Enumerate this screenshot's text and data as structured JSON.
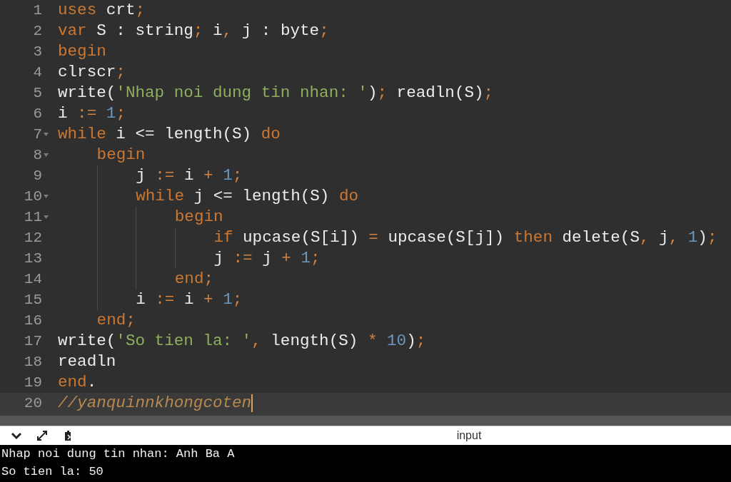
{
  "editor": {
    "lines": [
      {
        "number": "1",
        "foldable": false,
        "active": false,
        "tokens": [
          {
            "kind": "kw",
            "text": "uses"
          },
          {
            "kind": "id",
            "text": " crt"
          },
          {
            "kind": "op",
            "text": ";"
          }
        ]
      },
      {
        "number": "2",
        "foldable": false,
        "active": false,
        "tokens": [
          {
            "kind": "kw",
            "text": "var"
          },
          {
            "kind": "id",
            "text": " S : string"
          },
          {
            "kind": "op",
            "text": ";"
          },
          {
            "kind": "id",
            "text": " i"
          },
          {
            "kind": "op",
            "text": ","
          },
          {
            "kind": "id",
            "text": " j : byte"
          },
          {
            "kind": "op",
            "text": ";"
          }
        ]
      },
      {
        "number": "3",
        "foldable": false,
        "active": false,
        "tokens": [
          {
            "kind": "kw",
            "text": "begin"
          }
        ]
      },
      {
        "number": "4",
        "foldable": false,
        "active": false,
        "tokens": [
          {
            "kind": "id",
            "text": "clrscr"
          },
          {
            "kind": "op",
            "text": ";"
          }
        ]
      },
      {
        "number": "5",
        "foldable": false,
        "active": false,
        "tokens": [
          {
            "kind": "id",
            "text": "write("
          },
          {
            "kind": "str",
            "text": "'Nhap noi dung tin nhan: '"
          },
          {
            "kind": "id",
            "text": ")"
          },
          {
            "kind": "op",
            "text": ";"
          },
          {
            "kind": "id",
            "text": " readln(S)"
          },
          {
            "kind": "op",
            "text": ";"
          }
        ]
      },
      {
        "number": "6",
        "foldable": false,
        "active": false,
        "tokens": [
          {
            "kind": "id",
            "text": "i"
          },
          {
            "kind": "op",
            "text": " :="
          },
          {
            "kind": "num",
            "text": " 1"
          },
          {
            "kind": "op",
            "text": ";"
          }
        ]
      },
      {
        "number": "7",
        "foldable": true,
        "active": false,
        "tokens": [
          {
            "kind": "kw",
            "text": "while"
          },
          {
            "kind": "id",
            "text": " i <= length(S)"
          },
          {
            "kind": "kw",
            "text": " do"
          }
        ],
        "children": [
          {
            "number": "8",
            "foldable": true,
            "active": false,
            "tokens": [
              {
                "kind": "kw",
                "text": "begin"
              }
            ],
            "children": [
              {
                "number": "9",
                "foldable": false,
                "active": false,
                "tokens": [
                  {
                    "kind": "id",
                    "text": "j"
                  },
                  {
                    "kind": "op",
                    "text": " :="
                  },
                  {
                    "kind": "id",
                    "text": " i"
                  },
                  {
                    "kind": "op",
                    "text": " +"
                  },
                  {
                    "kind": "num",
                    "text": " 1"
                  },
                  {
                    "kind": "op",
                    "text": ";"
                  }
                ]
              },
              {
                "number": "10",
                "foldable": true,
                "active": false,
                "tokens": [
                  {
                    "kind": "kw",
                    "text": "while"
                  },
                  {
                    "kind": "id",
                    "text": " j <= length(S)"
                  },
                  {
                    "kind": "kw",
                    "text": " do"
                  }
                ],
                "children": [
                  {
                    "number": "11",
                    "foldable": true,
                    "active": false,
                    "tokens": [
                      {
                        "kind": "kw",
                        "text": "begin"
                      }
                    ],
                    "children": [
                      {
                        "number": "12",
                        "foldable": false,
                        "active": false,
                        "tokens": [
                          {
                            "kind": "kw",
                            "text": "if"
                          },
                          {
                            "kind": "id",
                            "text": " upcase(S[i])"
                          },
                          {
                            "kind": "op",
                            "text": " ="
                          },
                          {
                            "kind": "id",
                            "text": " upcase(S[j])"
                          },
                          {
                            "kind": "kw",
                            "text": " then"
                          },
                          {
                            "kind": "id",
                            "text": " delete(S"
                          },
                          {
                            "kind": "op",
                            "text": ","
                          },
                          {
                            "kind": "id",
                            "text": " j"
                          },
                          {
                            "kind": "op",
                            "text": ","
                          },
                          {
                            "kind": "num",
                            "text": " 1"
                          },
                          {
                            "kind": "id",
                            "text": ")"
                          },
                          {
                            "kind": "op",
                            "text": ";"
                          }
                        ]
                      },
                      {
                        "number": "13",
                        "foldable": false,
                        "active": false,
                        "tokens": [
                          {
                            "kind": "id",
                            "text": "j"
                          },
                          {
                            "kind": "op",
                            "text": " :="
                          },
                          {
                            "kind": "id",
                            "text": " j"
                          },
                          {
                            "kind": "op",
                            "text": " +"
                          },
                          {
                            "kind": "num",
                            "text": " 1"
                          },
                          {
                            "kind": "op",
                            "text": ";"
                          }
                        ]
                      }
                    ]
                  },
                  {
                    "number": "14",
                    "foldable": false,
                    "active": false,
                    "tokens": [
                      {
                        "kind": "kw",
                        "text": "end"
                      },
                      {
                        "kind": "op",
                        "text": ";"
                      }
                    ]
                  }
                ]
              },
              {
                "number": "15",
                "foldable": false,
                "active": false,
                "tokens": [
                  {
                    "kind": "id",
                    "text": "i"
                  },
                  {
                    "kind": "op",
                    "text": " :="
                  },
                  {
                    "kind": "id",
                    "text": " i"
                  },
                  {
                    "kind": "op",
                    "text": " +"
                  },
                  {
                    "kind": "num",
                    "text": " 1"
                  },
                  {
                    "kind": "op",
                    "text": ";"
                  }
                ]
              }
            ]
          },
          {
            "number": "16",
            "foldable": false,
            "active": false,
            "tokens": [
              {
                "kind": "kw",
                "text": "end"
              },
              {
                "kind": "op",
                "text": ";"
              }
            ]
          }
        ]
      },
      {
        "number": "17",
        "foldable": false,
        "active": false,
        "tokens": [
          {
            "kind": "id",
            "text": "write("
          },
          {
            "kind": "str",
            "text": "'So tien la: '"
          },
          {
            "kind": "op",
            "text": ","
          },
          {
            "kind": "id",
            "text": " length(S)"
          },
          {
            "kind": "op",
            "text": " *"
          },
          {
            "kind": "num",
            "text": " 10"
          },
          {
            "kind": "id",
            "text": ")"
          },
          {
            "kind": "op",
            "text": ";"
          }
        ]
      },
      {
        "number": "18",
        "foldable": false,
        "active": false,
        "tokens": [
          {
            "kind": "id",
            "text": "readln"
          }
        ]
      },
      {
        "number": "19",
        "foldable": false,
        "active": false,
        "tokens": [
          {
            "kind": "kw",
            "text": "end"
          },
          {
            "kind": "id",
            "text": "."
          }
        ]
      },
      {
        "number": "20",
        "foldable": false,
        "active": true,
        "tokens": [
          {
            "kind": "cmt",
            "text": "//yanquinnkhongcoten"
          }
        ]
      }
    ]
  },
  "console": {
    "label": "input",
    "output": [
      "Nhap noi dung tin nhan: Anh Ba A",
      "So tien la: 50"
    ]
  }
}
